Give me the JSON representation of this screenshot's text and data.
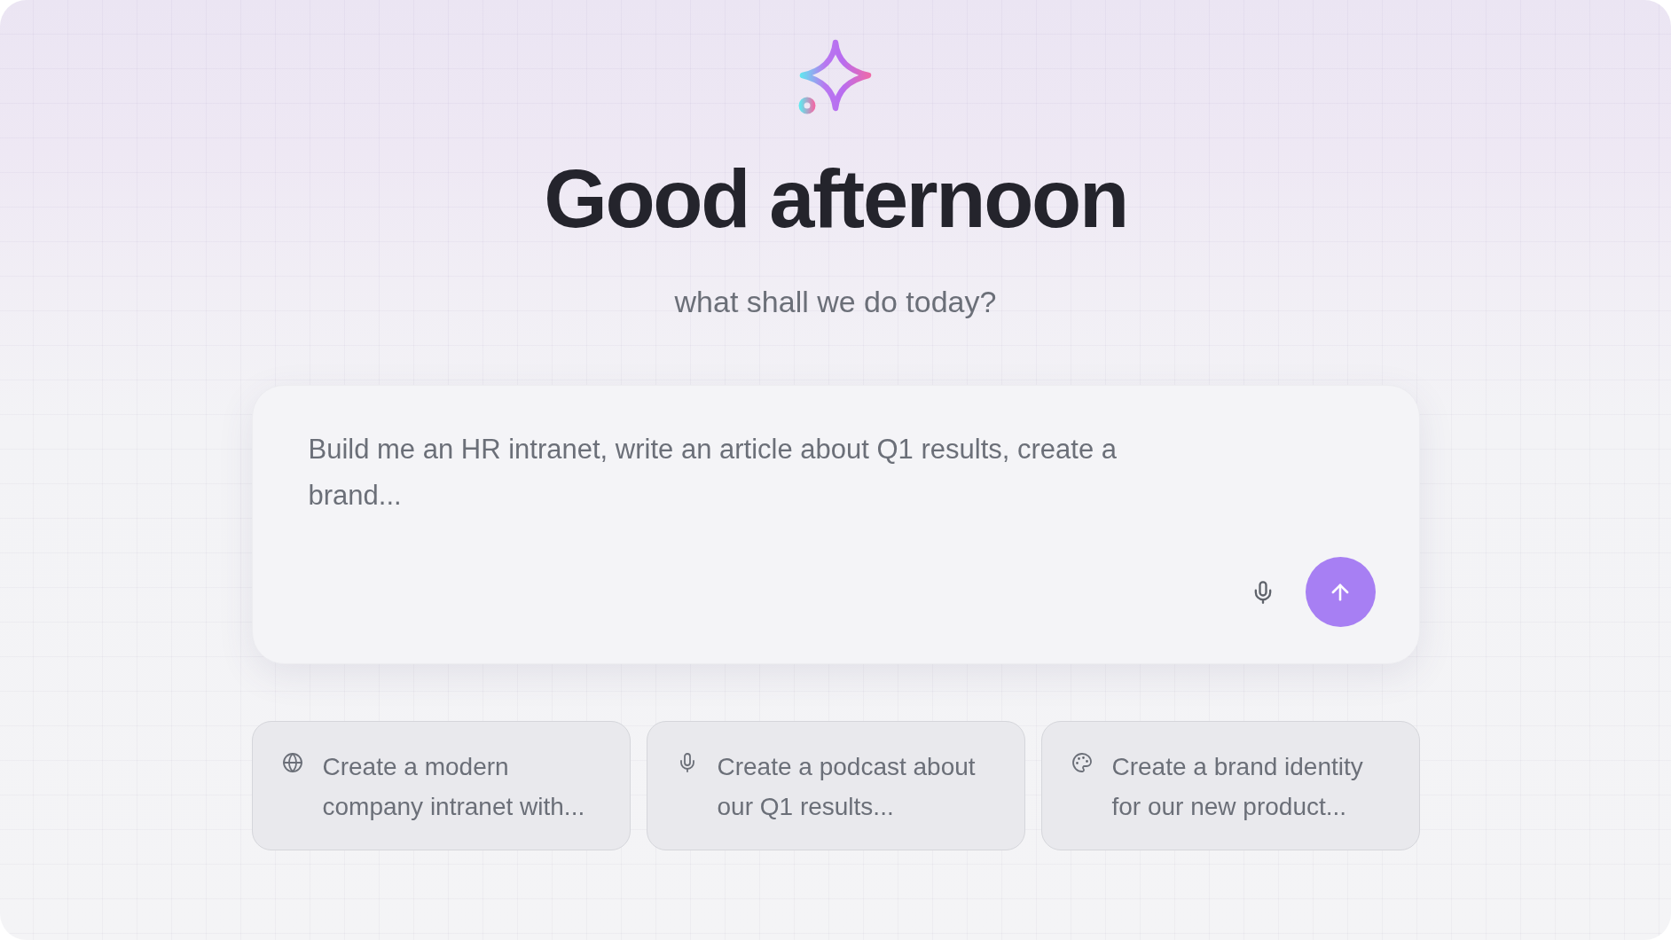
{
  "greeting": {
    "title": "Good afternoon",
    "subtitle": "what shall we do today?"
  },
  "prompt": {
    "placeholder": "Build me an HR intranet, write an article about Q1 results, create a brand..."
  },
  "suggestions": [
    {
      "kind": "website",
      "label": "Create a modern company intranet with..."
    },
    {
      "kind": "podcast",
      "label": "Create a podcast about our Q1 results..."
    },
    {
      "kind": "brand",
      "label": "Create a brand identity for our new product..."
    }
  ]
}
